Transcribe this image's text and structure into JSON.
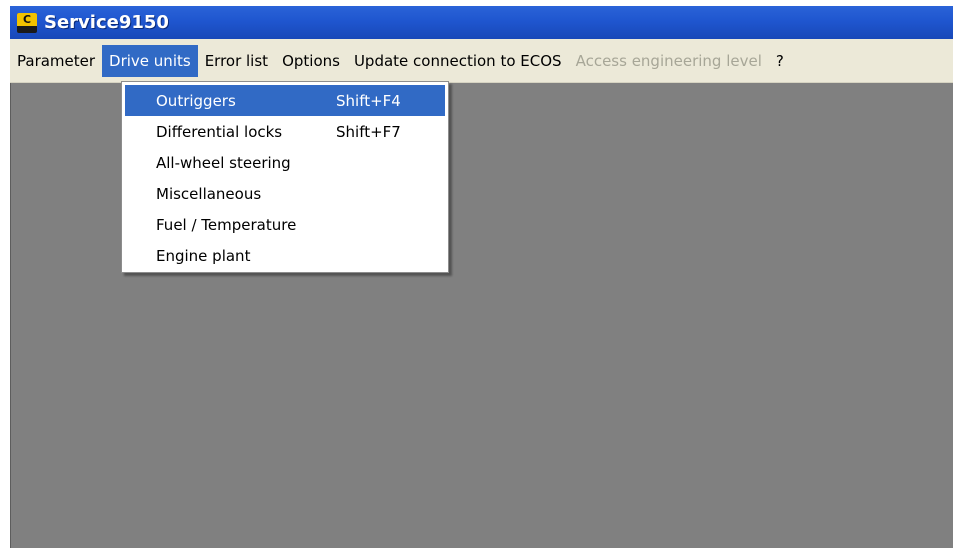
{
  "window": {
    "title": "Service9150",
    "icon": "app-logo-icon"
  },
  "menubar": {
    "items": [
      {
        "label": "Parameter",
        "state": "normal"
      },
      {
        "label": "Drive units",
        "state": "active"
      },
      {
        "label": "Error list",
        "state": "normal"
      },
      {
        "label": "Options",
        "state": "normal"
      },
      {
        "label": "Update connection to ECOS",
        "state": "normal"
      },
      {
        "label": "Access engineering level",
        "state": "disabled"
      },
      {
        "label": "?",
        "state": "normal"
      }
    ]
  },
  "dropdown": {
    "items": [
      {
        "label": "Outriggers",
        "shortcut": "Shift+F4",
        "highlighted": true
      },
      {
        "label": "Differential locks",
        "shortcut": "Shift+F7",
        "highlighted": false
      },
      {
        "label": "All-wheel steering",
        "shortcut": "",
        "highlighted": false
      },
      {
        "label": "Miscellaneous",
        "shortcut": "",
        "highlighted": false
      },
      {
        "label": "Fuel / Temperature",
        "shortcut": "",
        "highlighted": false
      },
      {
        "label": "Engine plant",
        "shortcut": "",
        "highlighted": false
      }
    ]
  },
  "colors": {
    "titlebar": "#2a63d8",
    "menubar": "#ece9d8",
    "highlight": "#316ac5",
    "workspace": "#808080",
    "disabled_text": "#a7a697"
  }
}
